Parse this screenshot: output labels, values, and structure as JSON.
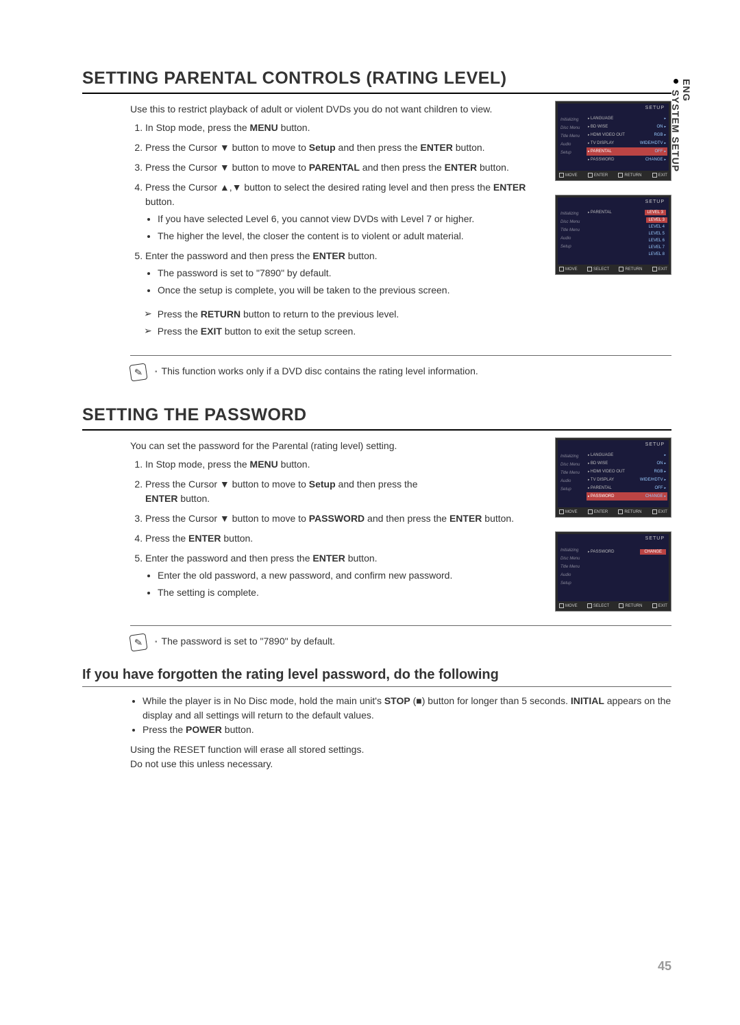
{
  "side": {
    "lang": "ENG",
    "section": "SYSTEM SETUP"
  },
  "section1": {
    "heading": "SETTING PARENTAL CONTROLS (RATING LEVEL)",
    "intro": "Use this to restrict playback of adult or violent DVDs you do not want children to view.",
    "step1_a": "In Stop mode, press the ",
    "step1_b": "MENU",
    "step1_c": " button.",
    "step2_a": "Press the Cursor ▼ button to move to ",
    "step2_b": "Setup",
    "step2_c": " and then press the ",
    "step2_d": "ENTER",
    "step2_e": " button.",
    "step3_a": "Press the Cursor ▼ button to move to ",
    "step3_b": "PARENTAL",
    "step3_c": " and then press the ",
    "step3_d": "ENTER",
    "step3_e": " button.",
    "step4_a": "Press the Cursor ▲,▼ button to select the desired rating level and then press the ",
    "step4_b": "ENTER",
    "step4_c": " button.",
    "step4_sub1": "If you have selected Level 6, you cannot view DVDs with Level 7 or higher.",
    "step4_sub2": "The higher the level, the closer the content is to violent or adult material.",
    "step5_a": "Enter the password and then press the ",
    "step5_b": "ENTER",
    "step5_c": " button.",
    "step5_sub1": "The password is set to \"7890\" by default.",
    "step5_sub2": "Once the setup is complete, you will be taken to the previous screen.",
    "pointer1_a": "Press the ",
    "pointer1_b": "RETURN",
    "pointer1_c": " button to return to the previous level.",
    "pointer2_a": "Press the ",
    "pointer2_b": "EXIT",
    "pointer2_c": " button to exit the setup screen.",
    "note": "This function works only if a DVD disc contains the rating level information."
  },
  "section2": {
    "heading": "SETTING THE PASSWORD",
    "intro": "You can set the password for the Parental (rating level) setting.",
    "step1_a": "In Stop mode, press the ",
    "step1_b": "MENU",
    "step1_c": " button.",
    "step2_a": "Press the Cursor ▼ button to move to ",
    "step2_b": "Setup",
    "step2_c": " and then press the ",
    "step2_d": "ENTER",
    "step2_e": " button.",
    "step3_a": "Press the Cursor ▼ button to move to ",
    "step3_b": "PASSWORD",
    "step3_c": " and then press the ",
    "step3_d": "ENTER",
    "step3_e": " button.",
    "step4_a": "Press the ",
    "step4_b": "ENTER",
    "step4_c": " button.",
    "step5_a": "Enter the password and then press the ",
    "step5_b": "ENTER",
    "step5_c": " button.",
    "step5_sub1": "Enter the old password, a new password, and confirm new password.",
    "step5_sub2": "The setting is complete.",
    "note": "The password is set to \"7890\" by default."
  },
  "forgot": {
    "heading": "If you have forgotten the rating level password, do the following",
    "b1_a": "While the player is in No Disc mode, hold the main unit's ",
    "b1_b": "STOP",
    "b1_c": " (■) button for longer than 5 seconds. ",
    "b1_d": "INITIAL",
    "b1_e": " appears on the display and all settings will return to the default values.",
    "b2_a": "Press the ",
    "b2_b": "POWER",
    "b2_c": " button.",
    "tail1": "Using the RESET function will erase all stored settings.",
    "tail2": "Do not use this unless necessary."
  },
  "shots": {
    "setup": "SETUP",
    "leftTabs": [
      "Initializing",
      "Disc Menu",
      "Title Menu",
      "Audio",
      "Setup"
    ],
    "menu1": [
      {
        "lbl": "LANGUAGE",
        "val": "",
        "sel": false
      },
      {
        "lbl": "BD WISE",
        "val": "ON",
        "sel": false
      },
      {
        "lbl": "HDMI VIDEO OUT",
        "val": "RGB",
        "sel": false
      },
      {
        "lbl": "TV DISPLAY",
        "val": "WIDE/HDTV",
        "sel": false
      },
      {
        "lbl": "PARENTAL",
        "val": "OFF",
        "sel": true
      },
      {
        "lbl": "PASSWORD",
        "val": "CHANGE",
        "sel": false
      }
    ],
    "footer_move": "MOVE",
    "footer_enter": "ENTER",
    "footer_select": "SELECT",
    "footer_return": "RETURN",
    "footer_exit": "EXIT",
    "levels": [
      "LEVEL 3",
      "LEVEL 3",
      "LEVEL 4",
      "LEVEL 5",
      "LEVEL 6",
      "LEVEL 7",
      "LEVEL 8"
    ],
    "parental_lbl": "PARENTAL",
    "password_lbl": "PASSWORD",
    "change": "CHANGE",
    "menu3": [
      {
        "lbl": "LANGUAGE",
        "val": "",
        "sel": false
      },
      {
        "lbl": "BD WISE",
        "val": "ON",
        "sel": false
      },
      {
        "lbl": "HDMI VIDEO OUT",
        "val": "RGB",
        "sel": false
      },
      {
        "lbl": "TV DISPLAY",
        "val": "WIDE/HDTV",
        "sel": false
      },
      {
        "lbl": "PARENTAL",
        "val": "OFF",
        "sel": false
      },
      {
        "lbl": "PASSWORD",
        "val": "CHANGE",
        "sel": true
      }
    ]
  },
  "pageNum": "45"
}
